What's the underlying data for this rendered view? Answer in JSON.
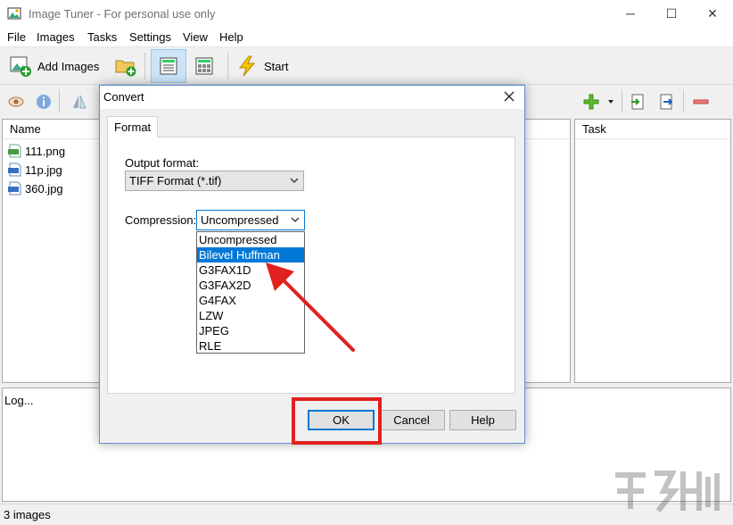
{
  "window": {
    "title": "Image Tuner - For personal use only",
    "controls": [
      "─",
      "☐",
      "✕"
    ]
  },
  "menu": [
    "File",
    "Images",
    "Tasks",
    "Settings",
    "View",
    "Help"
  ],
  "toolbar": {
    "add_images_label": "Add Images",
    "start_label": "Start"
  },
  "files_panel": {
    "header": "Name",
    "files": [
      {
        "name": "111.png",
        "icon": "png-file-icon"
      },
      {
        "name": "11p.jpg",
        "icon": "jpg-file-icon"
      },
      {
        "name": "360.jpg",
        "icon": "jpg-file-icon"
      }
    ]
  },
  "tasks_panel": {
    "header": "Task"
  },
  "log_panel": {
    "text": "Log..."
  },
  "statusbar": {
    "text": "3 images"
  },
  "dialog": {
    "title": "Convert",
    "tab": "Format",
    "output_format_label": "Output format:",
    "output_format_value": "TIFF Format (*.tif)",
    "compression_label": "Compression:",
    "compression_value": "Uncompressed",
    "compression_options": [
      "Uncompressed",
      "Bilevel Huffman",
      "G3FAX1D",
      "G3FAX2D",
      "G4FAX",
      "LZW",
      "JPEG",
      "RLE"
    ],
    "highlighted_option": "Bilevel Huffman",
    "ok_label": "OK",
    "cancel_label": "Cancel",
    "help_label": "Help"
  },
  "colors": {
    "accent": "#0078d7",
    "annotation": "#e0211d"
  }
}
